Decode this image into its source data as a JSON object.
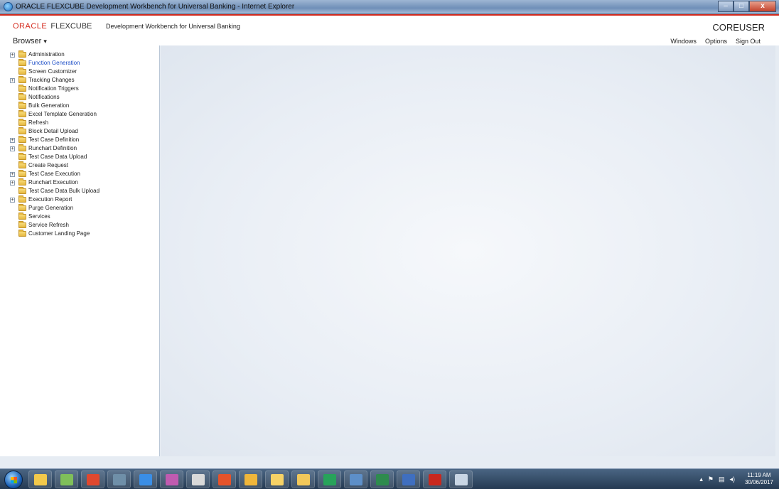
{
  "window": {
    "title": "ORACLE FLEXCUBE Development Workbench for Universal Banking - Internet Explorer",
    "controls": {
      "minimize": "–",
      "maximize": "□",
      "close": "x"
    }
  },
  "header": {
    "brand_oracle": "ORACLE",
    "brand_product": "FLEXCUBE",
    "app_name": "Development Workbench for Universal Banking",
    "user": "COREUSER",
    "browser_menu": "Browser",
    "browser_caret": "▾",
    "nav": [
      "Windows",
      "Options",
      "Sign Out"
    ]
  },
  "sidebar": {
    "items": [
      {
        "label": "Administration",
        "expandable": true,
        "active": false
      },
      {
        "label": "Function Generation",
        "expandable": false,
        "active": true
      },
      {
        "label": "Screen Customizer",
        "expandable": false,
        "active": false
      },
      {
        "label": "Tracking Changes",
        "expandable": true,
        "active": false
      },
      {
        "label": "Notification Triggers",
        "expandable": false,
        "active": false
      },
      {
        "label": "Notifications",
        "expandable": false,
        "active": false
      },
      {
        "label": "Bulk Generation",
        "expandable": false,
        "active": false
      },
      {
        "label": "Excel Template Generation",
        "expandable": false,
        "active": false
      },
      {
        "label": "Refresh",
        "expandable": false,
        "active": false
      },
      {
        "label": "Block Detail Upload",
        "expandable": false,
        "active": false
      },
      {
        "label": "Test Case Definition",
        "expandable": true,
        "active": false
      },
      {
        "label": "Runchart Definition",
        "expandable": true,
        "active": false
      },
      {
        "label": "Test Case Data Upload",
        "expandable": false,
        "active": false
      },
      {
        "label": "Create Request",
        "expandable": false,
        "active": false
      },
      {
        "label": "Test Case Execution",
        "expandable": true,
        "active": false
      },
      {
        "label": "Runchart Execution",
        "expandable": true,
        "active": false
      },
      {
        "label": "Test Case Data Bulk Upload",
        "expandable": false,
        "active": false
      },
      {
        "label": "Execution Report",
        "expandable": true,
        "active": false
      },
      {
        "label": "Purge Generation",
        "expandable": false,
        "active": false
      },
      {
        "label": "Services",
        "expandable": false,
        "active": false
      },
      {
        "label": "Service Refresh",
        "expandable": false,
        "active": false
      },
      {
        "label": "Customer Landing Page",
        "expandable": false,
        "active": false
      }
    ],
    "expander_glyph": "+"
  },
  "taskbar": {
    "apps": [
      {
        "icon": "folder-icon",
        "color": "#f3c94b"
      },
      {
        "icon": "image-viewer-icon",
        "color": "#7fbf5a"
      },
      {
        "icon": "chrome-icon",
        "color": "#e0482f"
      },
      {
        "icon": "network-icon",
        "color": "#6f8fa8"
      },
      {
        "icon": "internet-explorer-icon",
        "color": "#3a8ee6"
      },
      {
        "icon": "media-icon",
        "color": "#c05bb0"
      },
      {
        "icon": "paint-icon",
        "color": "#d9d9d9"
      },
      {
        "icon": "browser-icon",
        "color": "#e5532b"
      },
      {
        "icon": "files-icon",
        "color": "#f0b63a"
      },
      {
        "icon": "mail-icon",
        "color": "#f6d266"
      },
      {
        "icon": "outlook-icon",
        "color": "#f2c85a"
      },
      {
        "icon": "skype-icon",
        "color": "#27a35a"
      },
      {
        "icon": "remote-desktop-icon",
        "color": "#5d8fc8"
      },
      {
        "icon": "excel-icon",
        "color": "#2e8b4e"
      },
      {
        "icon": "word-icon",
        "color": "#3f6fc0"
      },
      {
        "icon": "acrobat-icon",
        "color": "#c8281e"
      },
      {
        "icon": "settings-icon",
        "color": "#c9d6e4"
      }
    ],
    "tray": [
      "▴",
      "⚑",
      "▤",
      "◂)"
    ],
    "time": "11:19 AM",
    "date": "30/06/2017"
  }
}
